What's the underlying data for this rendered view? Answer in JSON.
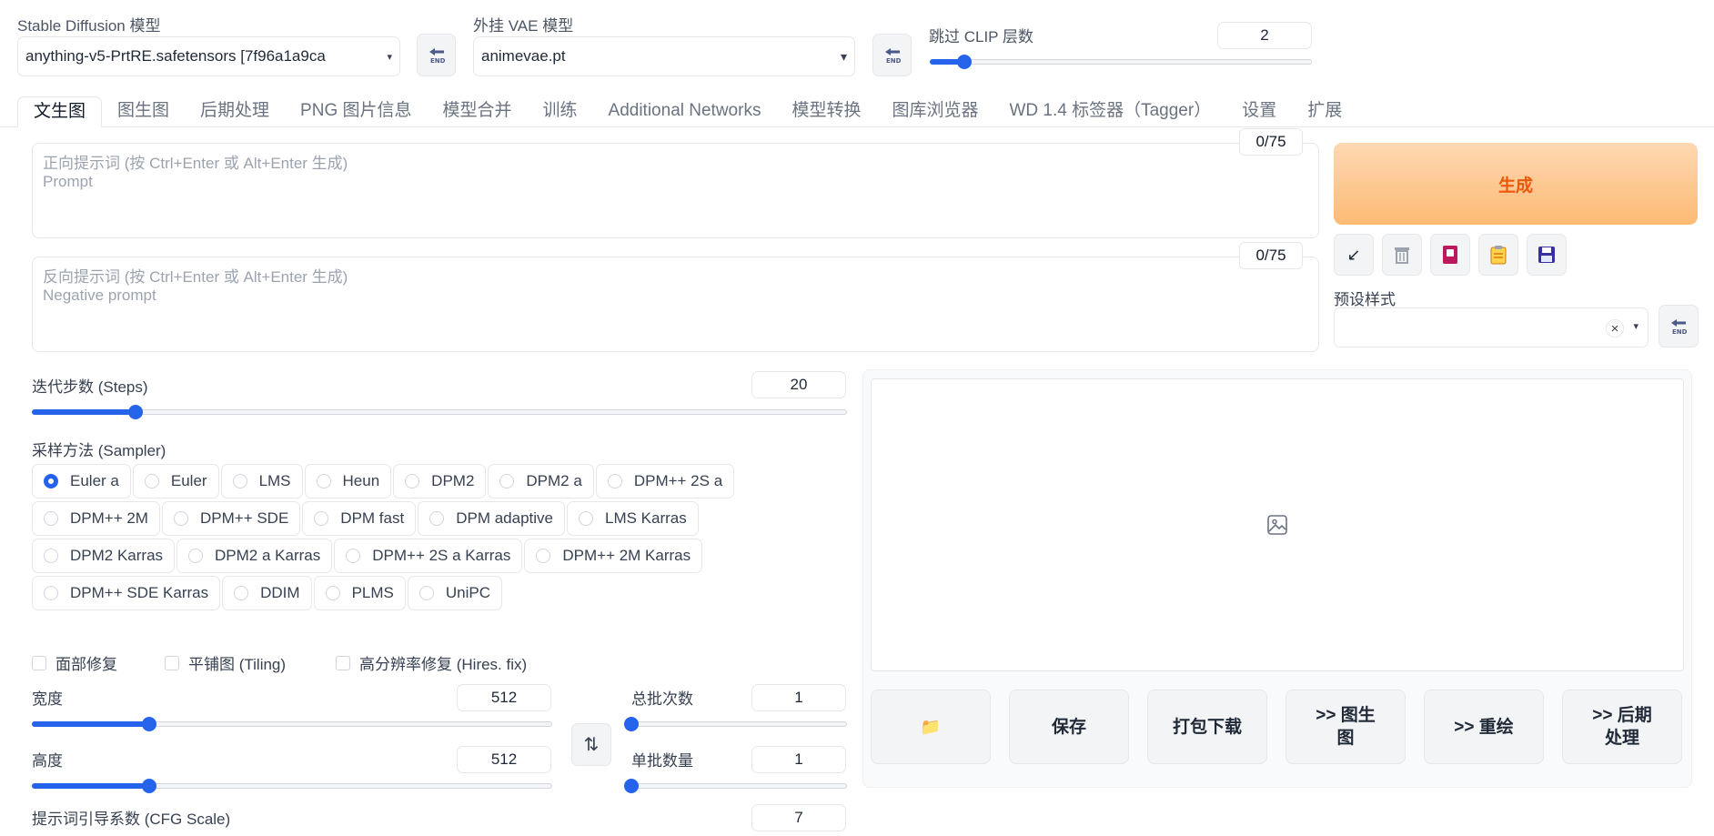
{
  "top": {
    "model_label": "Stable Diffusion 模型",
    "model_value": "anything-v5-PrtRE.safetensors [7f96a1a9ca",
    "vae_label": "外挂 VAE 模型",
    "vae_value": "animevae.pt",
    "clip_label": "跳过 CLIP 层数",
    "clip_value": "2",
    "clip_min": 1,
    "clip_max": 12
  },
  "tabs": [
    "文生图",
    "图生图",
    "后期处理",
    "PNG 图片信息",
    "模型合并",
    "训练",
    "Additional Networks",
    "模型转换",
    "图库浏览器",
    "WD 1.4 标签器（Tagger）",
    "设置",
    "扩展"
  ],
  "prompt": {
    "placeholder_line1": "正向提示词 (按 Ctrl+Enter 或 Alt+Enter 生成)",
    "placeholder_line2": "Prompt",
    "counter": "0/75"
  },
  "negative": {
    "placeholder_line1": "反向提示词 (按 Ctrl+Enter 或 Alt+Enter 生成)",
    "placeholder_line2": "Negative prompt",
    "counter": "0/75"
  },
  "generate_label": "生成",
  "toolbar_icons": [
    "arrow-icon",
    "trash-icon",
    "card-icon",
    "clipboard-icon",
    "save-icon"
  ],
  "styles_label": "预设样式",
  "styles_clear": "×",
  "steps": {
    "label": "迭代步数 (Steps)",
    "value": "20",
    "min": 1,
    "max": 150
  },
  "sampler": {
    "label": "采样方法 (Sampler)",
    "selected": "Euler a",
    "rows": [
      [
        "Euler a",
        "Euler",
        "LMS",
        "Heun",
        "DPM2",
        "DPM2 a",
        "DPM++ 2S a"
      ],
      [
        "DPM++ 2M",
        "DPM++ SDE",
        "DPM fast",
        "DPM adaptive",
        "LMS Karras"
      ],
      [
        "DPM2 Karras",
        "DPM2 a Karras",
        "DPM++ 2S a Karras",
        "DPM++ 2M Karras"
      ],
      [
        "DPM++ SDE Karras",
        "DDIM",
        "PLMS",
        "UniPC"
      ]
    ]
  },
  "checks": [
    "面部修复",
    "平铺图 (Tiling)",
    "高分辨率修复 (Hires. fix)"
  ],
  "width": {
    "label": "宽度",
    "value": "512",
    "min": 64,
    "max": 2048
  },
  "height": {
    "label": "高度",
    "value": "512",
    "min": 64,
    "max": 2048
  },
  "batch_count": {
    "label": "总批次数",
    "value": "1",
    "min": 1,
    "max": 100
  },
  "batch_size": {
    "label": "单批数量",
    "value": "1",
    "min": 1,
    "max": 8
  },
  "cfg": {
    "label": "提示词引导系数 (CFG Scale)",
    "value": "7"
  },
  "swap_label": "⇅",
  "output_buttons": {
    "folder": "📁",
    "save": "保存",
    "zip": "打包下载",
    "to_img2img_line1": ">> 图生",
    "to_img2img_line2": "图",
    "to_inpaint": ">> 重绘",
    "to_extras_line1": ">> 后期",
    "to_extras_line2": "处理"
  }
}
